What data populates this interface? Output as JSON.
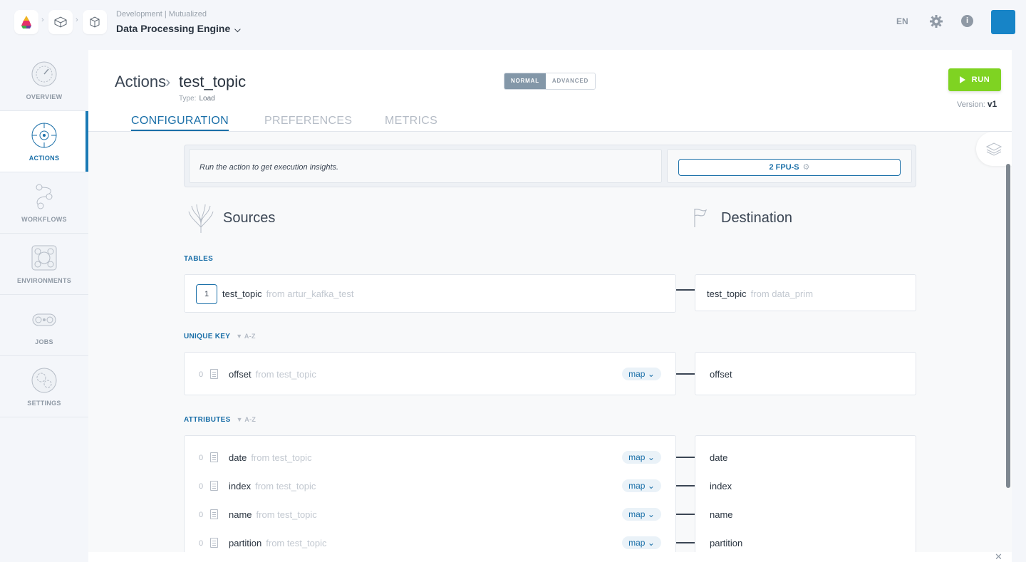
{
  "header": {
    "org_label": "Development | Mutualized",
    "org_title": "Data Processing Engine",
    "lang": "EN"
  },
  "sidebar": {
    "items": [
      {
        "label": "OVERVIEW",
        "icon": "gauge-icon"
      },
      {
        "label": "ACTIONS",
        "icon": "target-icon"
      },
      {
        "label": "WORKFLOWS",
        "icon": "workflow-icon"
      },
      {
        "label": "ENVIRONMENTS",
        "icon": "environment-icon"
      },
      {
        "label": "JOBS",
        "icon": "jobs-icon"
      },
      {
        "label": "SETTINGS",
        "icon": "gears-icon"
      }
    ],
    "active": "ACTIONS"
  },
  "page": {
    "crumb_root": "Actions",
    "crumb_name": "test_topic",
    "type_label": "Type:",
    "type_value": "Load",
    "mode_normal": "NORMAL",
    "mode_advanced": "ADVANCED",
    "run_label": "RUN",
    "version_label": "Version:",
    "version_value": "v1",
    "tabs": [
      "CONFIGURATION",
      "PREFERENCES",
      "METRICS"
    ],
    "active_tab": "CONFIGURATION"
  },
  "insights": {
    "message": "Run the action to get execution insights.",
    "fpu": "2 FPU-S"
  },
  "sources_title": "Sources",
  "destination_title": "Destination",
  "tables": {
    "label": "TABLES",
    "source": {
      "badge": "1",
      "name": "test_topic",
      "from": "from artur_kafka_test"
    },
    "destination": {
      "name": "test_topic",
      "from": "from data_prim"
    }
  },
  "unique_key": {
    "label": "UNIQUE KEY",
    "sort": "A-Z",
    "rows": [
      {
        "index": "0",
        "name": "offset",
        "from": "from test_topic",
        "map": "map",
        "dest": "offset"
      }
    ]
  },
  "attributes": {
    "label": "ATTRIBUTES",
    "sort": "A-Z",
    "rows": [
      {
        "index": "0",
        "name": "date",
        "from": "from test_topic",
        "map": "map",
        "dest": "date"
      },
      {
        "index": "0",
        "name": "index",
        "from": "from test_topic",
        "map": "map",
        "dest": "index"
      },
      {
        "index": "0",
        "name": "name",
        "from": "from test_topic",
        "map": "map",
        "dest": "name"
      },
      {
        "index": "0",
        "name": "partition",
        "from": "from test_topic",
        "map": "map",
        "dest": "partition"
      }
    ]
  },
  "colors": {
    "accent": "#1a6fa8",
    "run": "#7fd322",
    "mode_active": "#8397a8"
  }
}
